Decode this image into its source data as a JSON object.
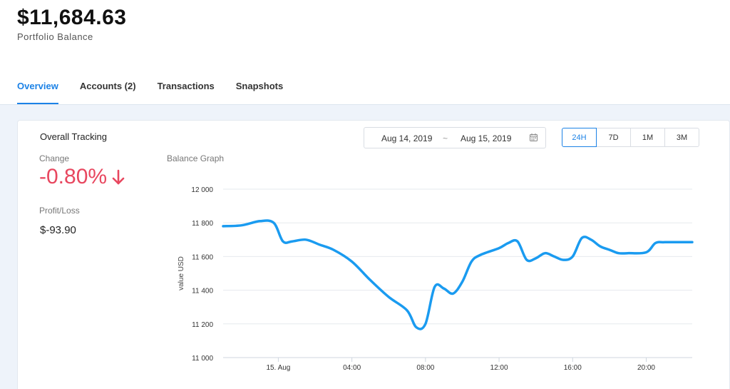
{
  "header": {
    "balance": "$11,684.63",
    "balance_label": "Portfolio Balance"
  },
  "tabs": [
    {
      "label": "Overview",
      "active": true
    },
    {
      "label": "Accounts (2)",
      "active": false
    },
    {
      "label": "Transactions",
      "active": false
    },
    {
      "label": "Snapshots",
      "active": false
    }
  ],
  "card": {
    "title": "Overall Tracking",
    "date_from": "Aug 14, 2019",
    "date_separator": "~",
    "date_to": "Aug 15, 2019",
    "calendar_icon": "calendar-icon",
    "ranges": [
      {
        "label": "24H",
        "active": true
      },
      {
        "label": "7D",
        "active": false
      },
      {
        "label": "1M",
        "active": false
      },
      {
        "label": "3M",
        "active": false
      }
    ],
    "change_label": "Change",
    "change_value": "-0.80%",
    "change_icon": "arrow-down-icon",
    "profit_label": "Profit/Loss",
    "profit_value": "$-93.90",
    "graph_label": "Balance Graph"
  },
  "colors": {
    "accent": "#1c82e6",
    "negative": "#e8475f",
    "line": "#1a9bf0"
  },
  "chart_data": {
    "type": "line",
    "ylabel": "value USD",
    "ylim": [
      11000,
      12000
    ],
    "yticks": [
      {
        "value": 11000,
        "label": "11 000"
      },
      {
        "value": 11200,
        "label": "11 200"
      },
      {
        "value": 11400,
        "label": "11 400"
      },
      {
        "value": 11600,
        "label": "11 600"
      },
      {
        "value": 11800,
        "label": "11 800"
      },
      {
        "value": 12000,
        "label": "12 000"
      }
    ],
    "xlim": [
      "2019-08-14T21:00",
      "2019-08-15T22:30"
    ],
    "xticks": [
      {
        "value": "2019-08-15T00:00",
        "label": "15. Aug"
      },
      {
        "value": "2019-08-15T04:00",
        "label": "04:00"
      },
      {
        "value": "2019-08-15T08:00",
        "label": "08:00"
      },
      {
        "value": "2019-08-15T12:00",
        "label": "12:00"
      },
      {
        "value": "2019-08-15T16:00",
        "label": "16:00"
      },
      {
        "value": "2019-08-15T20:00",
        "label": "20:00"
      }
    ],
    "grid": true,
    "series": [
      {
        "x": [
          "2019-08-14T21:00",
          "2019-08-14T22:00",
          "2019-08-14T23:00",
          "2019-08-14T23:45",
          "2019-08-15T00:15",
          "2019-08-15T00:45",
          "2019-08-15T01:30",
          "2019-08-15T02:15",
          "2019-08-15T03:00",
          "2019-08-15T04:00",
          "2019-08-15T05:00",
          "2019-08-15T06:00",
          "2019-08-15T07:00",
          "2019-08-15T07:30",
          "2019-08-15T08:00",
          "2019-08-15T08:30",
          "2019-08-15T09:00",
          "2019-08-15T09:30",
          "2019-08-15T10:00",
          "2019-08-15T10:30",
          "2019-08-15T11:00",
          "2019-08-15T12:00",
          "2019-08-15T12:30",
          "2019-08-15T13:00",
          "2019-08-15T13:30",
          "2019-08-15T14:00",
          "2019-08-15T14:30",
          "2019-08-15T15:00",
          "2019-08-15T15:30",
          "2019-08-15T16:00",
          "2019-08-15T16:30",
          "2019-08-15T17:00",
          "2019-08-15T17:30",
          "2019-08-15T18:00",
          "2019-08-15T18:30",
          "2019-08-15T19:00",
          "2019-08-15T20:00",
          "2019-08-15T20:30",
          "2019-08-15T21:00",
          "2019-08-15T22:00",
          "2019-08-15T22:30"
        ],
        "values": [
          11780,
          11785,
          11810,
          11800,
          11690,
          11690,
          11700,
          11670,
          11640,
          11570,
          11460,
          11360,
          11280,
          11180,
          11200,
          11420,
          11410,
          11380,
          11450,
          11570,
          11610,
          11650,
          11680,
          11690,
          11580,
          11590,
          11620,
          11600,
          11580,
          11600,
          11710,
          11700,
          11660,
          11640,
          11620,
          11620,
          11625,
          11680,
          11685,
          11685,
          11685
        ]
      }
    ]
  }
}
